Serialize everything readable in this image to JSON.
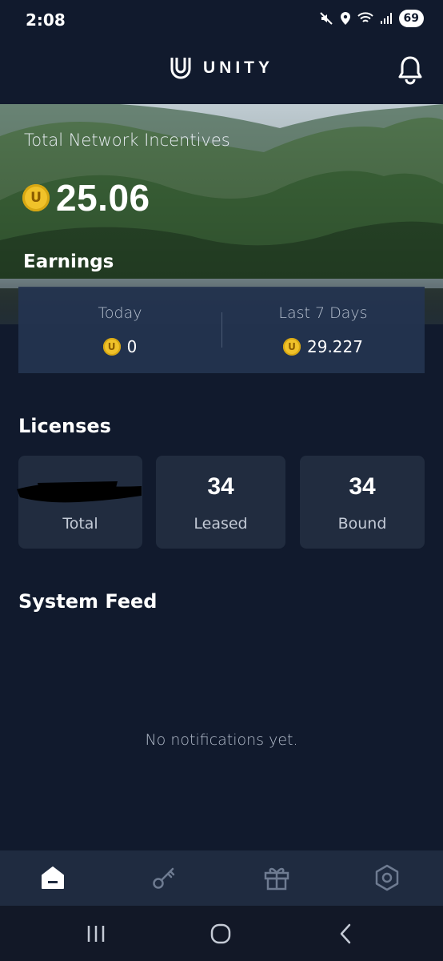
{
  "status_bar": {
    "time": "2:08",
    "battery": "69"
  },
  "header": {
    "brand": "UNITY",
    "logo_icon": "unity-u-logo",
    "bell_icon": "bell-icon"
  },
  "hero": {
    "label": "Total Network Incentives",
    "coin_symbol": "U",
    "value": "25.06"
  },
  "earnings": {
    "title": "Earnings",
    "today": {
      "label": "Today",
      "value": "0"
    },
    "last7": {
      "label": "Last 7 Days",
      "value": "29.227"
    }
  },
  "licenses": {
    "title": "Licenses",
    "cards": [
      {
        "value": "",
        "label": "Total",
        "redacted": true
      },
      {
        "value": "34",
        "label": "Leased"
      },
      {
        "value": "34",
        "label": "Bound"
      }
    ]
  },
  "feed": {
    "title": "System Feed",
    "empty_text": "No notifications yet."
  },
  "tabs": [
    {
      "icon": "home-icon",
      "active": true
    },
    {
      "icon": "key-icon",
      "active": false
    },
    {
      "icon": "gift-icon",
      "active": false
    },
    {
      "icon": "settings-hexagon-icon",
      "active": false
    }
  ],
  "colors": {
    "background": "#111a2d",
    "card": "#212c3f",
    "coin": "#f0c22a",
    "tab_bar": "#1f2b40"
  }
}
